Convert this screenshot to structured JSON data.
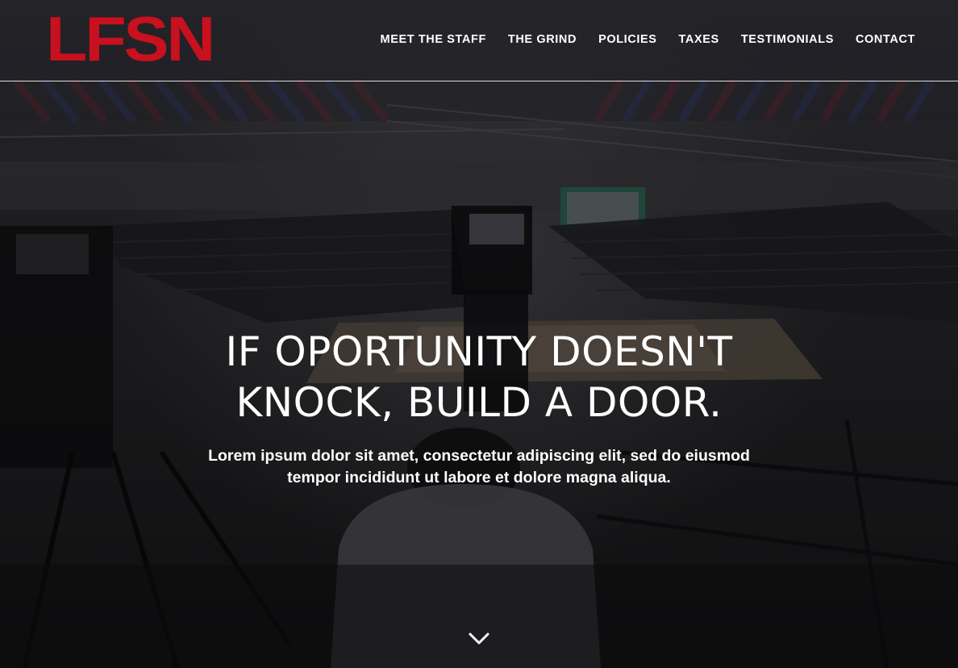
{
  "logo": {
    "text": "LFSN",
    "color": "#c8101e"
  },
  "nav": {
    "items": [
      {
        "label": "MEET THE STAFF"
      },
      {
        "label": "THE GRIND"
      },
      {
        "label": "POLICIES"
      },
      {
        "label": "TAXES"
      },
      {
        "label": "TESTIMONIALS"
      },
      {
        "label": "CONTACT"
      }
    ]
  },
  "hero": {
    "headline_line1": "IF OPORTUNITY DOESN'T",
    "headline_line2": "KNOCK, BUILD A DOOR.",
    "subtext_line1": "Lorem ipsum dolor sit amet, consectetur adipiscing elit, sed do eiusmod",
    "subtext_line2": "tempor incididunt ut labore et dolore magna aliqua.",
    "background_image": "darkened photo of an indoor basketball arena viewed from a camera platform",
    "scroll_icon": "chevron-down-icon"
  }
}
